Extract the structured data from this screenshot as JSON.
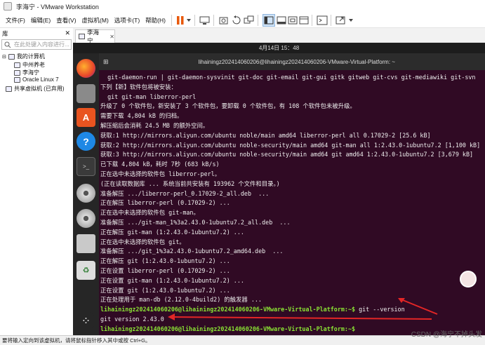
{
  "window": {
    "title": "李海宁 - VMware Workstation"
  },
  "menu": [
    "文件(F)",
    "编辑(E)",
    "查看(V)",
    "虚拟机(M)",
    "选项卡(T)",
    "帮助(H)"
  ],
  "library": {
    "title": "库",
    "search_placeholder": "在此处键入内容进行..."
  },
  "tree": {
    "root": "我的计算机",
    "vms": [
      "中州养老",
      "李海宁",
      "Oracle Linux 7"
    ],
    "shared": "共享虚拟机 (已弃用)"
  },
  "tab": {
    "label": "李海宁"
  },
  "guest": {
    "clock": "4月14日 15：48",
    "terminal_title": "lihainingz202414060206@lihainingz202414060206-VMware-Virtual-Platform: ~"
  },
  "terminal": {
    "lines": [
      {
        "text": "  git-daemon-run | git-daemon-sysvinit git-doc git-email git-gui gitk gitweb git-cvs git-mediawiki git-svn"
      },
      {
        "text": "下列【新】软件包将被安装："
      },
      {
        "text": "  git git-man liberror-perl"
      },
      {
        "text": "升级了 0 个软件包，新安装了 3 个软件包，要卸载 0 个软件包，有 108 个软件包未被升级。"
      },
      {
        "text": "需要下载 4,804 kB 的归档。"
      },
      {
        "text": "解压缩后会消耗 24.5 MB 的额外空间。"
      },
      {
        "text": "获取:1 http://mirrors.aliyun.com/ubuntu noble/main amd64 liberror-perl all 0.17029-2 [25.6 kB]"
      },
      {
        "text": "获取:2 http://mirrors.aliyun.com/ubuntu noble-security/main amd64 git-man all 1:2.43.0-1ubuntu7.2 [1,100 kB]"
      },
      {
        "text": "获取:3 http://mirrors.aliyun.com/ubuntu noble-security/main amd64 git amd64 1:2.43.0-1ubuntu7.2 [3,679 kB]"
      },
      {
        "text": "已下载 4,804 kB，耗时 7秒 (683 kB/s)"
      },
      {
        "text": "正在选中未选择的软件包 liberror-perl。"
      },
      {
        "text": "(正在读取数据库 ... 系统当前共安装有 193962 个文件和目录。)"
      },
      {
        "text": "准备解压 .../liberror-perl_0.17029-2_all.deb  ..."
      },
      {
        "text": "正在解压 liberror-perl (0.17029-2) ..."
      },
      {
        "text": "正在选中未选择的软件包 git-man。"
      },
      {
        "text": "准备解压 .../git-man_1%3a2.43.0-1ubuntu7.2_all.deb  ..."
      },
      {
        "text": "正在解压 git-man (1:2.43.0-1ubuntu7.2) ..."
      },
      {
        "text": "正在选中未选择的软件包 git。"
      },
      {
        "text": "准备解压 .../git_1%3a2.43.0-1ubuntu7.2_amd64.deb  ..."
      },
      {
        "text": "正在解压 git (1:2.43.0-1ubuntu7.2) ..."
      },
      {
        "text": "正在设置 liberror-perl (0.17029-2) ..."
      },
      {
        "text": "正在设置 git-man (1:2.43.0-1ubuntu7.2) ..."
      },
      {
        "text": "正在设置 git (1:2.43.0-1ubuntu7.2) ..."
      },
      {
        "text": "正在处理用于 man-db (2.12.0-4build2) 的触发器 ..."
      },
      {
        "prompt": "lihainingz202414060206@lihainingz202414060206-VMware-Virtual-Platform:~$",
        "text": " git --version"
      },
      {
        "text": "git version 2.43.0"
      },
      {
        "prompt": "lihainingz202414060206@lihainingz202414060206-VMware-Virtual-Platform:~$",
        "text": ""
      }
    ]
  },
  "statusbar": {
    "text": "要将输入定向到该虚拟机，请将鼠标指针移入其中或按 Ctrl+G。"
  },
  "watermark": "CSDN @海宁不掉头发",
  "colors": {
    "terminal_bg": "#300a24",
    "prompt": "#8ae234",
    "arrow": "#e32626",
    "pause": "#e8590c"
  }
}
